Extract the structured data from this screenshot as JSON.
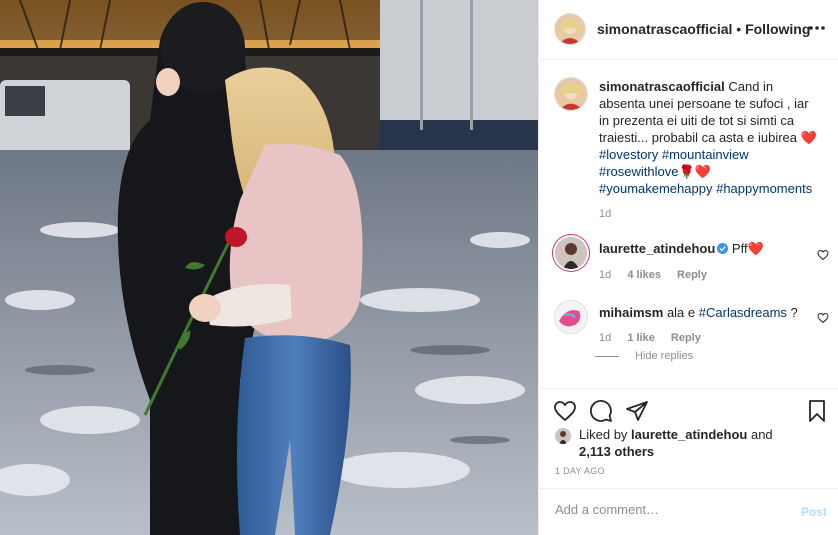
{
  "post": {
    "author": "simonatrascaofficial",
    "separator": "•",
    "follow_status": "Following",
    "caption": {
      "text": "Cand in absenta unei persoane te sufoci , iar in prezenta ei uiti de tot si simti ca traiesti... probabil ca asta e iubirea",
      "emoji_heart": "❤️",
      "tag1": "#lovestory",
      "tag2": "#mountainview",
      "tag3": "#rosewithlove",
      "emoji_rose_heart": "🌹❤️",
      "tag4": "#youmakemehappy",
      "tag5": "#happymoments",
      "age": "1d"
    },
    "comments": [
      {
        "user": "laurette_atindehou",
        "text": "Pff",
        "emoji": "❤️",
        "age": "1d",
        "likes": "4 likes",
        "reply": "Reply"
      },
      {
        "user": "mihaimsm",
        "text": "ala e",
        "tag": "#Carlasdreams",
        "suffix": "?",
        "age": "1d",
        "likes": "1 like",
        "reply": "Reply"
      }
    ],
    "hide_replies": "Hide replies",
    "liked_by_prefix": "Liked by",
    "liked_by_user": "laurette_atindehou",
    "liked_by_and": "and",
    "liked_by_others": "2,113 others",
    "posted_ago": "1 DAY AGO",
    "add_comment_placeholder": "Add a comment…",
    "post_button": "Post"
  },
  "colors": {
    "link": "#00376b",
    "muted": "#8e8e8e",
    "post_disabled": "#b2dffc",
    "heart_red": "#ed4956"
  },
  "icons": [
    "more-icon",
    "heart-icon",
    "comment-icon",
    "share-icon",
    "bookmark-icon",
    "verified-icon"
  ]
}
